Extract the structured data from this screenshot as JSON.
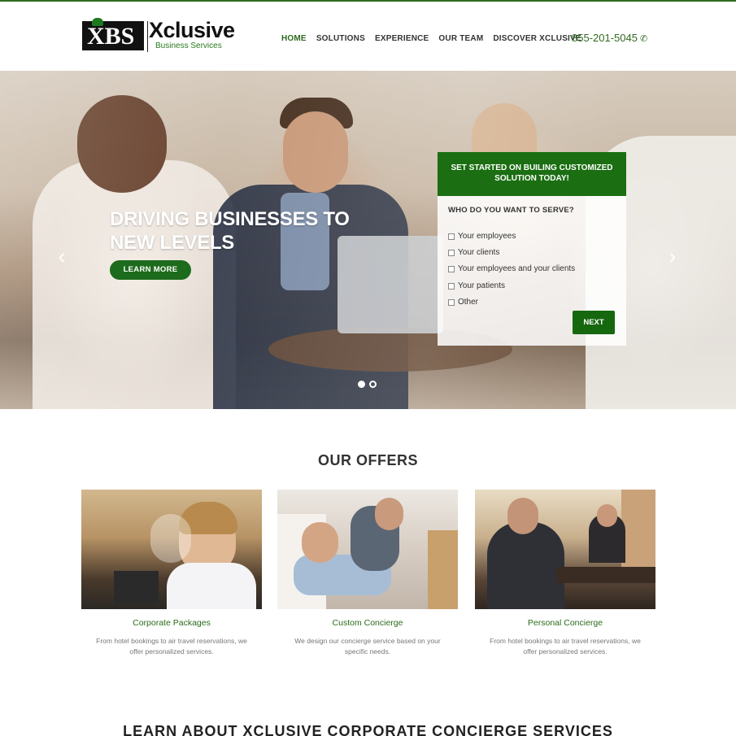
{
  "brand": {
    "logo_mark": "XBS",
    "logo_word": "Xclusive",
    "logo_sub": "Business Services"
  },
  "nav": {
    "items": [
      {
        "label": "HOME",
        "active": true
      },
      {
        "label": "SOLUTIONS",
        "active": false
      },
      {
        "label": "EXPERIENCE",
        "active": false
      },
      {
        "label": "OUR TEAM",
        "active": false
      },
      {
        "label": "DISCOVER XCLUSIVE",
        "active": false
      }
    ],
    "phone": "855-201-5045",
    "phone_icon": "phone-icon"
  },
  "hero": {
    "title": "DRIVING BUSINESSES TO NEW LEVELS",
    "button_label": "LEARN MORE",
    "prev_icon": "‹",
    "next_icon": "›",
    "slide_count": 2,
    "active_slide": 1
  },
  "form": {
    "header": "SET STARTED ON BUILING CUSTOMIZED SOLUTION TODAY!",
    "question": "WHO DO YOU WANT TO SERVE?",
    "options": [
      "Your employees",
      "Your clients",
      "Your employees and your clients",
      "Your patients",
      "Other"
    ],
    "next_label": "NEXT"
  },
  "offers": {
    "title": "OUR OFFERS",
    "cards": [
      {
        "name": "Corporate Packages",
        "desc": "From hotel bookings to air travel reservations, we offer personalized services."
      },
      {
        "name": "Custom Concierge",
        "desc": "We design our concierge service based on your specific needs."
      },
      {
        "name": "Personal Concierge",
        "desc": "From hotel bookings to air travel reservations, we offer personalized services."
      }
    ]
  },
  "learn": {
    "title": "LEARN ABOUT XCLUSIVE CORPORATE CONCIERGE SERVICES"
  },
  "colors": {
    "brand_green": "#1b6e12",
    "nav_active": "#2e6b1f"
  }
}
